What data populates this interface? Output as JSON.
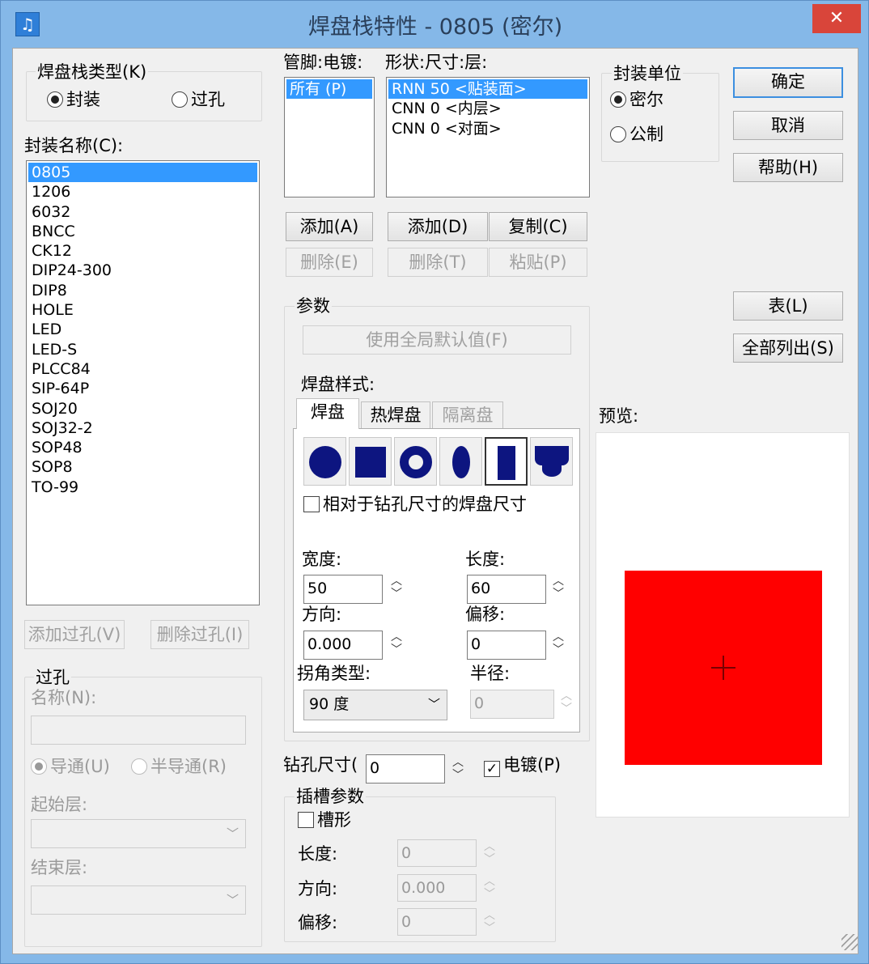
{
  "window": {
    "title": "焊盘栈特性 - 0805 (密尔)",
    "close_label": "✕",
    "icon_name": "app-icon"
  },
  "pad_stack_type": {
    "label": "焊盘栈类型(K)",
    "options": [
      "封装",
      "过孔"
    ],
    "selected": "封装"
  },
  "decal": {
    "label": "封装名称(C):",
    "items": [
      "0805",
      "1206",
      "6032",
      "BNCC",
      "CK12",
      "DIP24-300",
      "DIP8",
      "HOLE",
      "LED",
      "LED-S",
      "PLCC84",
      "SIP-64P",
      "SOJ20",
      "SOJ32-2",
      "SOP48",
      "SOP8",
      "TO-99"
    ],
    "selected": "0805"
  },
  "via_buttons": {
    "add": "添加过孔(V)",
    "delete": "删除过孔(I)"
  },
  "via": {
    "label": "过孔",
    "name_label": "名称(N):",
    "name_value": "",
    "options": [
      "导通(U)",
      "半导通(R)"
    ],
    "selected": "导通(U)",
    "start_layer_label": "起始层:",
    "end_layer_label": "结束层:"
  },
  "pin": {
    "label": "管脚:电镀:",
    "items": [
      "所有 (P)"
    ],
    "selected": "所有 (P)",
    "add": "添加(A)",
    "delete": "删除(E)"
  },
  "shape_list": {
    "label": "形状:尺寸:层:",
    "items": [
      "RNN 50 <贴装面>",
      "CNN 0 <内层>",
      "CNN 0 <对面>"
    ],
    "selected": "RNN 50 <贴装面>",
    "add": "添加(D)",
    "copy": "复制(C)",
    "delete": "删除(T)",
    "paste": "粘贴(P)"
  },
  "units": {
    "label": "封装单位",
    "options": [
      "密尔",
      "公制"
    ],
    "selected": "密尔"
  },
  "dialog_buttons": {
    "ok": "确定",
    "cancel": "取消",
    "help": "帮助(H)",
    "table": "表(L)",
    "list_all": "全部列出(S)"
  },
  "params": {
    "label": "参数",
    "use_global": "使用全局默认值(F)",
    "pad_style_label": "焊盘样式:",
    "tabs": [
      "焊盘",
      "热焊盘",
      "隔离盘"
    ],
    "active_tab": "焊盘",
    "shapes": [
      "round-pad-icon",
      "square-pad-icon",
      "annular-pad-icon",
      "oval-pad-icon",
      "rectangle-pad-icon",
      "odd-shape-pad-icon"
    ],
    "selected_shape": "rectangle-pad-icon",
    "relative_label": "相对于钻孔尺寸的焊盘尺寸",
    "relative_checked": false,
    "width_label": "宽度:",
    "width": "50",
    "length_label": "长度:",
    "length": "60",
    "orientation_label": "方向:",
    "orientation": "0.000",
    "offset_label": "偏移:",
    "offset": "0",
    "corner_label": "拐角类型:",
    "corner": "90 度",
    "radius_label": "半径:",
    "radius": "0"
  },
  "drill": {
    "label": "钻孔尺寸(",
    "value": "0",
    "plated_label": "电镀(P)",
    "plated_checked": true
  },
  "slot": {
    "label": "插槽参数",
    "slotted_label": "槽形",
    "slotted_checked": false,
    "length_label": "长度:",
    "length": "0",
    "orientation_label": "方向:",
    "orientation": "0.000",
    "offset_label": "偏移:",
    "offset": "0"
  },
  "preview": {
    "label": "预览:",
    "pad_color": "#ff0000",
    "pad_width": 50,
    "pad_length": 60
  },
  "colors": {
    "titlebar": "#85b8e8",
    "selection": "#3399ff",
    "close": "#d9453a",
    "pad_icon": "#0d1580"
  }
}
